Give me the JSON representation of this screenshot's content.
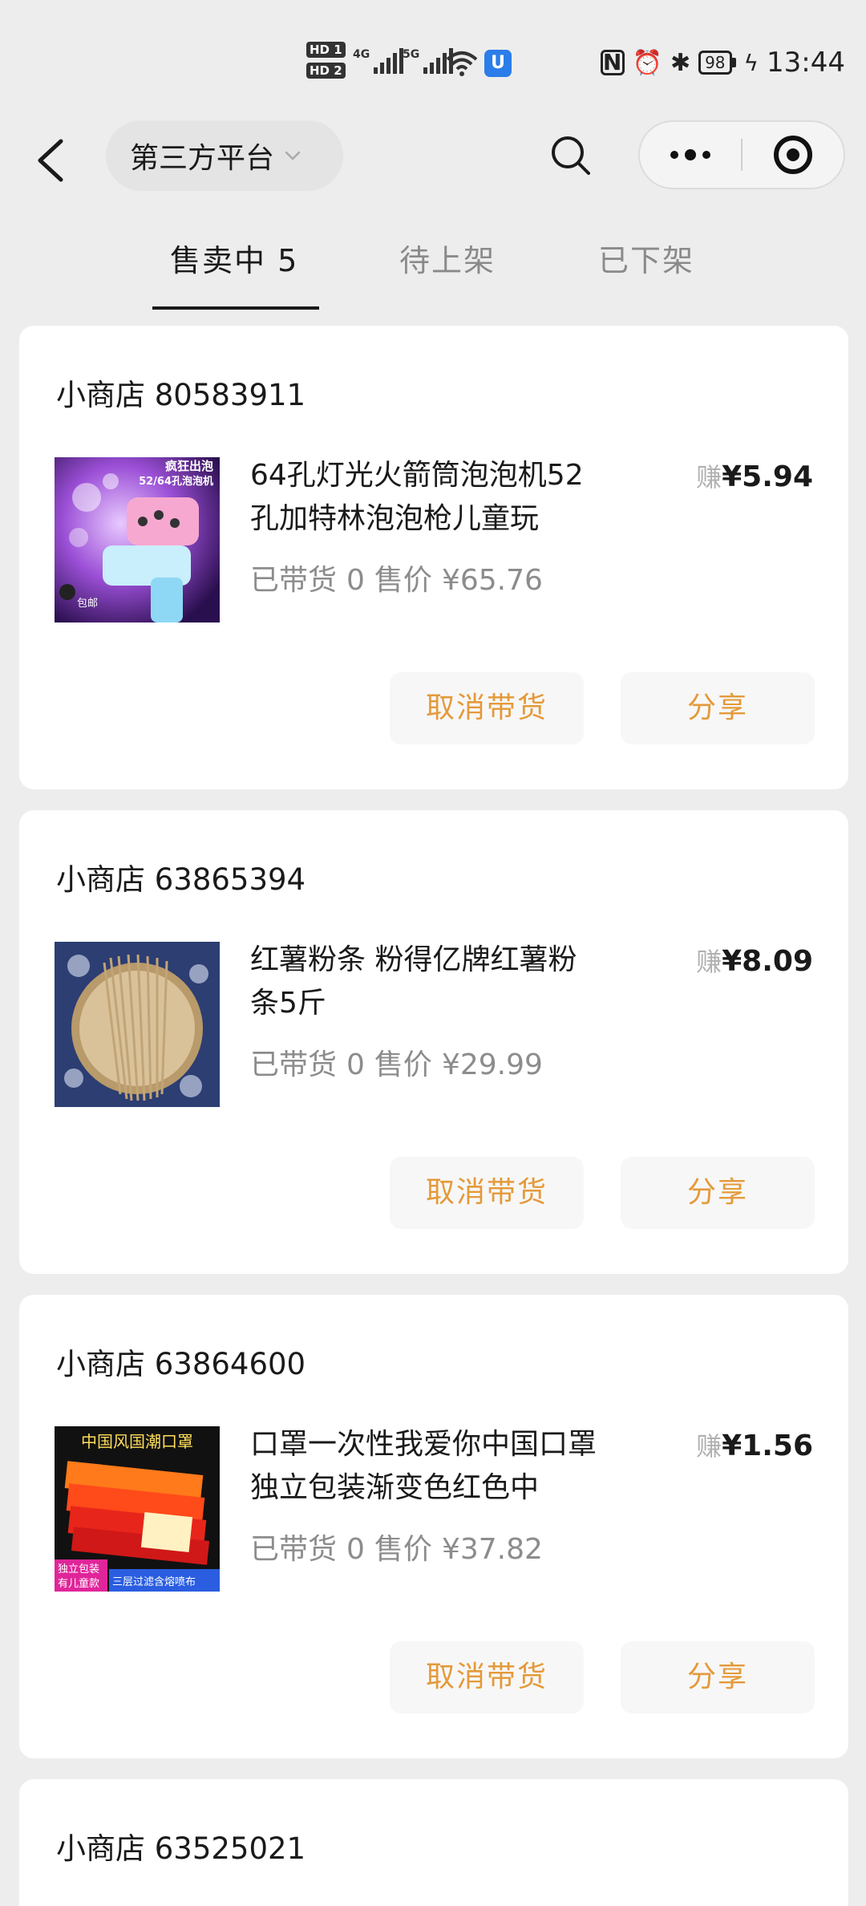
{
  "status_bar": {
    "hd1": "HD 1",
    "hd2": "HD 2",
    "sig1_label": "4G",
    "sig2_label": "5G",
    "app_icon": "U",
    "nfc": "N",
    "battery": "98",
    "time": "13:44"
  },
  "nav": {
    "platform_label": "第三方平台"
  },
  "tabs": [
    {
      "label": "售卖中 5"
    },
    {
      "label": "待上架"
    },
    {
      "label": "已下架"
    }
  ],
  "products": [
    {
      "shop": "小商店 80583911",
      "title": "64孔灯光火箭筒泡泡机52孔加特林泡泡枪儿童玩",
      "earn_label": "赚",
      "earn_value": "¥5.94",
      "carried_label": "已带货",
      "carried_count": "0",
      "price_label": "售价",
      "price": "¥65.76",
      "thumb_text_top": "疯狂出泡",
      "thumb_text_sub": "52/64孔泡泡机",
      "thumb_text_badge": "包邮"
    },
    {
      "shop": "小商店 63865394",
      "title": "红薯粉条 粉得亿牌红薯粉条5斤",
      "earn_label": "赚",
      "earn_value": "¥8.09",
      "carried_label": "已带货",
      "carried_count": "0",
      "price_label": "售价",
      "price": "¥29.99"
    },
    {
      "shop": "小商店 63864600",
      "title": "口罩一次性我爱你中国口罩独立包装渐变色红色中",
      "earn_label": "赚",
      "earn_value": "¥1.56",
      "carried_label": "已带货",
      "carried_count": "0",
      "price_label": "售价",
      "price": "¥37.82",
      "thumb_text_top": "中国风国潮口罩",
      "thumb_text_bl": "独立包装",
      "thumb_text_bl2": "有儿童款",
      "thumb_text_br": "三层过滤含熔喷布"
    },
    {
      "shop": "小商店 63525021"
    }
  ],
  "actions": {
    "cancel_label": "取消带货",
    "share_label": "分享"
  },
  "colors": {
    "accent": "#e49a3a",
    "background": "#ededed"
  },
  "icons": [
    "back-arrow-icon",
    "chevron-down-icon",
    "search-icon",
    "more-dots-icon",
    "close-target-icon"
  ]
}
